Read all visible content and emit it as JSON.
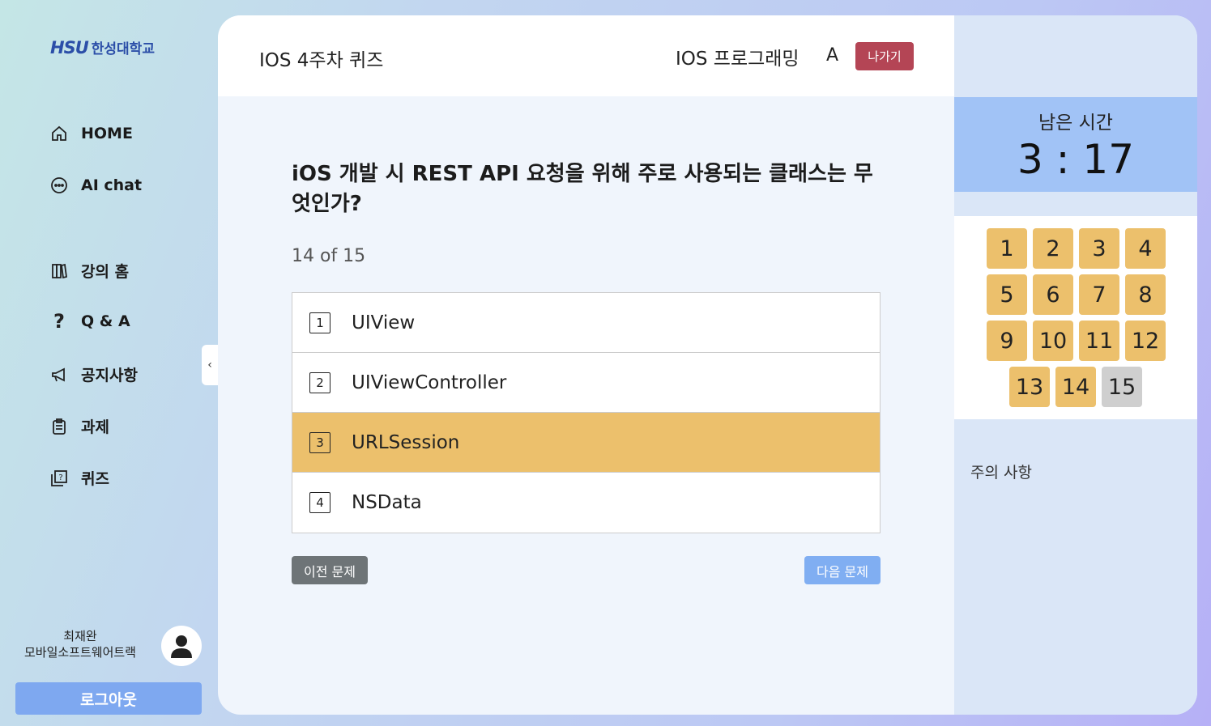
{
  "logo": {
    "mark": "HSU",
    "name": "한성대학교"
  },
  "nav": [
    {
      "label": "HOME",
      "icon": "home-icon"
    },
    {
      "label": "AI chat",
      "icon": "chat-icon"
    },
    {
      "label": "강의 홈",
      "icon": "books-icon"
    },
    {
      "label": "Q & A",
      "icon": "question-icon"
    },
    {
      "label": "공지사항",
      "icon": "megaphone-icon"
    },
    {
      "label": "과제",
      "icon": "clipboard-icon"
    },
    {
      "label": "퀴즈",
      "icon": "quiz-icon"
    }
  ],
  "user": {
    "name": "최재완",
    "track": "모바일소프트웨어트랙"
  },
  "logout_label": "로그아웃",
  "collapse_glyph": "‹",
  "header": {
    "quiz_title": "IOS 4주차 퀴즈",
    "course": "IOS 프로그래밍",
    "section": "A",
    "exit_label": "나가기"
  },
  "question": {
    "text": "iOS 개발 시 REST API 요청을 위해 주로 사용되는 클래스는 무엇인가?",
    "progress": "14 of 15",
    "options": [
      {
        "num": "1",
        "text": "UIView",
        "selected": false
      },
      {
        "num": "2",
        "text": "UIViewController",
        "selected": false
      },
      {
        "num": "3",
        "text": "URLSession",
        "selected": true
      },
      {
        "num": "4",
        "text": "NSData",
        "selected": false
      }
    ]
  },
  "buttons": {
    "prev": "이전 문제",
    "next": "다음 문제"
  },
  "timer": {
    "label": "남은 시간",
    "value": "3 : 17"
  },
  "question_grid": {
    "numbers": [
      "1",
      "2",
      "3",
      "4",
      "5",
      "6",
      "7",
      "8",
      "9",
      "10",
      "11",
      "12",
      "13",
      "14",
      "15"
    ],
    "current": "15"
  },
  "notice_title": "주의 사항",
  "colors": {
    "accent": "#ecc06c",
    "exit": "#b44555",
    "timer_bg": "#a1c3f6",
    "next_button": "#80aef2",
    "prev_button": "#6e7477"
  }
}
